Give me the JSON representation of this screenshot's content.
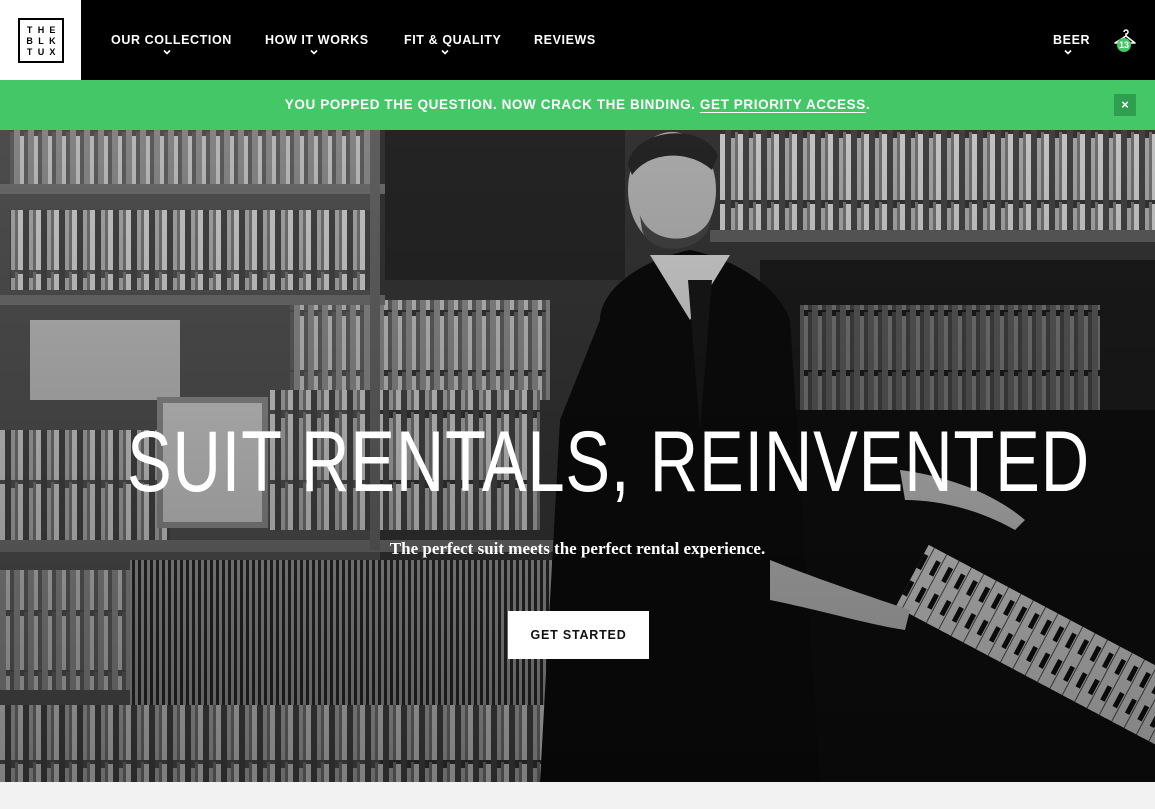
{
  "brand": {
    "logo_letters": [
      "T",
      "H",
      "E",
      "B",
      "L",
      "K",
      "T",
      "U",
      "X"
    ]
  },
  "nav": {
    "items": [
      {
        "label": "OUR COLLECTION",
        "has_dropdown": true
      },
      {
        "label": "HOW IT WORKS",
        "has_dropdown": true
      },
      {
        "label": "FIT & QUALITY",
        "has_dropdown": true
      },
      {
        "label": "REVIEWS",
        "has_dropdown": false
      }
    ],
    "account_label": "BEER",
    "cart_count": "13",
    "cart_icon": "hanger-icon"
  },
  "promo": {
    "text": "YOU POPPED THE QUESTION. NOW CRACK THE BINDING.",
    "link_label": "GET PRIORITY ACCESS",
    "suffix": ".",
    "close_label": "×"
  },
  "hero": {
    "title": "SUIT RENTALS, REINVENTED",
    "subtitle": "The perfect suit meets the perfect rental experience.",
    "cta_label": "GET STARTED"
  },
  "colors": {
    "accent": "#44c767",
    "nav_bg": "#000000",
    "promo_close_bg": "#2f9e4e"
  }
}
